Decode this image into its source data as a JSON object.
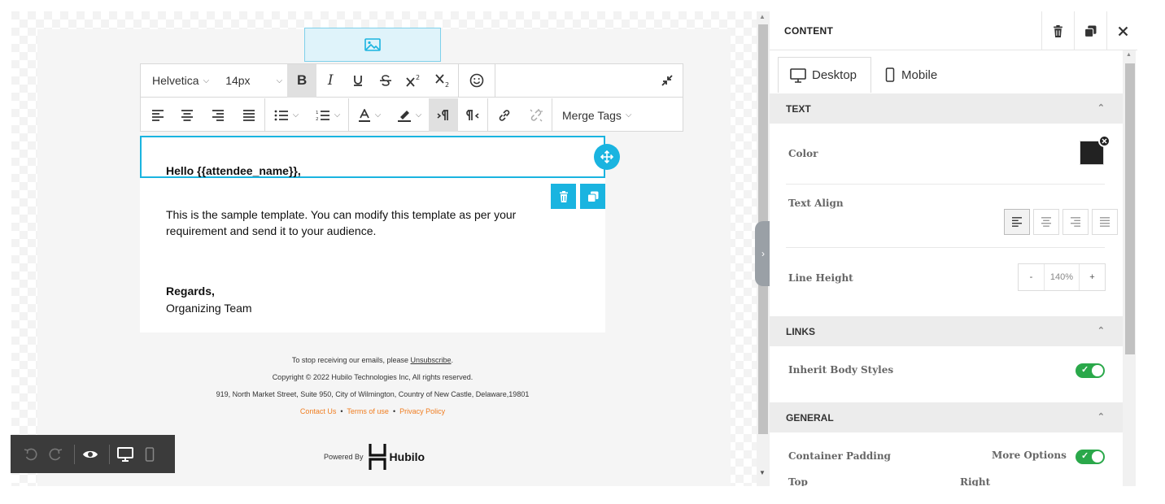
{
  "toolbar": {
    "font_family": "Helvetica",
    "font_size": "14px",
    "bold": "B",
    "italic": "I",
    "merge_tags": "Merge Tags"
  },
  "email": {
    "greeting": "Hello {{attendee_name}},",
    "body_line1": "This is the sample template. You can modify this template as per your",
    "body_line2": "requirement and send it to your audience.",
    "regards": "Regards,",
    "team": "Organizing Team"
  },
  "footer": {
    "unsubscribe_prefix": "To stop receiving our emails, please",
    "unsubscribe_link": "Unsubscribe",
    "unsubscribe_suffix": ".",
    "copyright": "Copyright © 2022 Hubilo Technologies Inc, All rights reserved.",
    "address": "919, North Market Street, Suite 950, City of Wilmington, Country of New Castle, Delaware,19801",
    "contact_us": "Contact Us",
    "terms": "Terms of use",
    "privacy": "Privacy Policy",
    "bullet": "•",
    "powered_by": "Powered By",
    "brand": "Hubilo"
  },
  "panel": {
    "title": "CONTENT",
    "tabs": [
      {
        "label": "Desktop",
        "icon": "monitor-icon",
        "active": true
      },
      {
        "label": "Mobile",
        "icon": "mobile-icon",
        "active": false
      }
    ],
    "sections": {
      "text": {
        "title": "TEXT",
        "color_label": "Color",
        "color_value": "#222222",
        "align_label": "Text Align",
        "line_height_label": "Line Height",
        "line_height_value": "140%",
        "minus": "-",
        "plus": "+"
      },
      "links": {
        "title": "LINKS",
        "inherit_label": "Inherit Body Styles",
        "inherit_on": true
      },
      "general": {
        "title": "GENERAL",
        "padding_label": "Container Padding",
        "more_options": "More Options",
        "top": "Top",
        "right": "Right"
      }
    }
  },
  "colors": {
    "accent": "#1ab4e0",
    "toggle_on": "#2aa84a",
    "link_orange": "#f07d20"
  }
}
